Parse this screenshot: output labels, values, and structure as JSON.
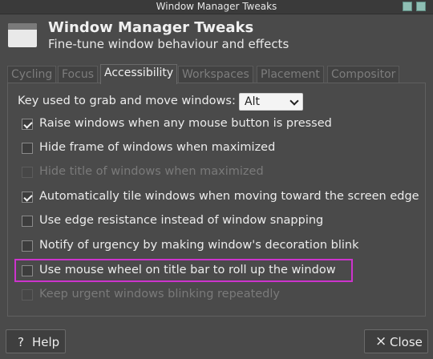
{
  "window": {
    "title": "Window Manager Tweaks"
  },
  "header": {
    "title": "Window Manager Tweaks",
    "subtitle": "Fine-tune window behaviour and effects",
    "icon": "window-icon"
  },
  "tabs": [
    {
      "label": "Cycling",
      "active": false
    },
    {
      "label": "Focus",
      "active": false
    },
    {
      "label": "Accessibility",
      "active": true
    },
    {
      "label": "Workspaces",
      "active": false
    },
    {
      "label": "Placement",
      "active": false
    },
    {
      "label": "Compositor",
      "active": false
    }
  ],
  "accessibility": {
    "grab_key_label": "Key used to grab and move windows:",
    "grab_key_value": "Alt",
    "options": [
      {
        "label": "Raise windows when any mouse button is pressed",
        "checked": true,
        "enabled": true
      },
      {
        "label": "Hide frame of windows when maximized",
        "checked": false,
        "enabled": true
      },
      {
        "label": "Hide title of windows when maximized",
        "checked": false,
        "enabled": false
      },
      {
        "label": "Automatically tile windows when moving toward the screen edge",
        "checked": true,
        "enabled": true
      },
      {
        "label": "Use edge resistance instead of window snapping",
        "checked": false,
        "enabled": true
      },
      {
        "label": "Notify of urgency by making window's decoration blink",
        "checked": false,
        "enabled": true
      },
      {
        "label": "Use mouse wheel on title bar to roll up the window",
        "checked": false,
        "enabled": true,
        "highlighted": true
      },
      {
        "label": "Keep urgent windows blinking repeatedly",
        "checked": false,
        "enabled": false
      }
    ]
  },
  "footer": {
    "help_label": "Help",
    "help_icon": "?",
    "close_label": "Close",
    "close_icon": "×"
  },
  "colors": {
    "background": "#4a4a4a",
    "titlebar_button": "#8fbfb4",
    "highlight": "#cc33cc"
  }
}
